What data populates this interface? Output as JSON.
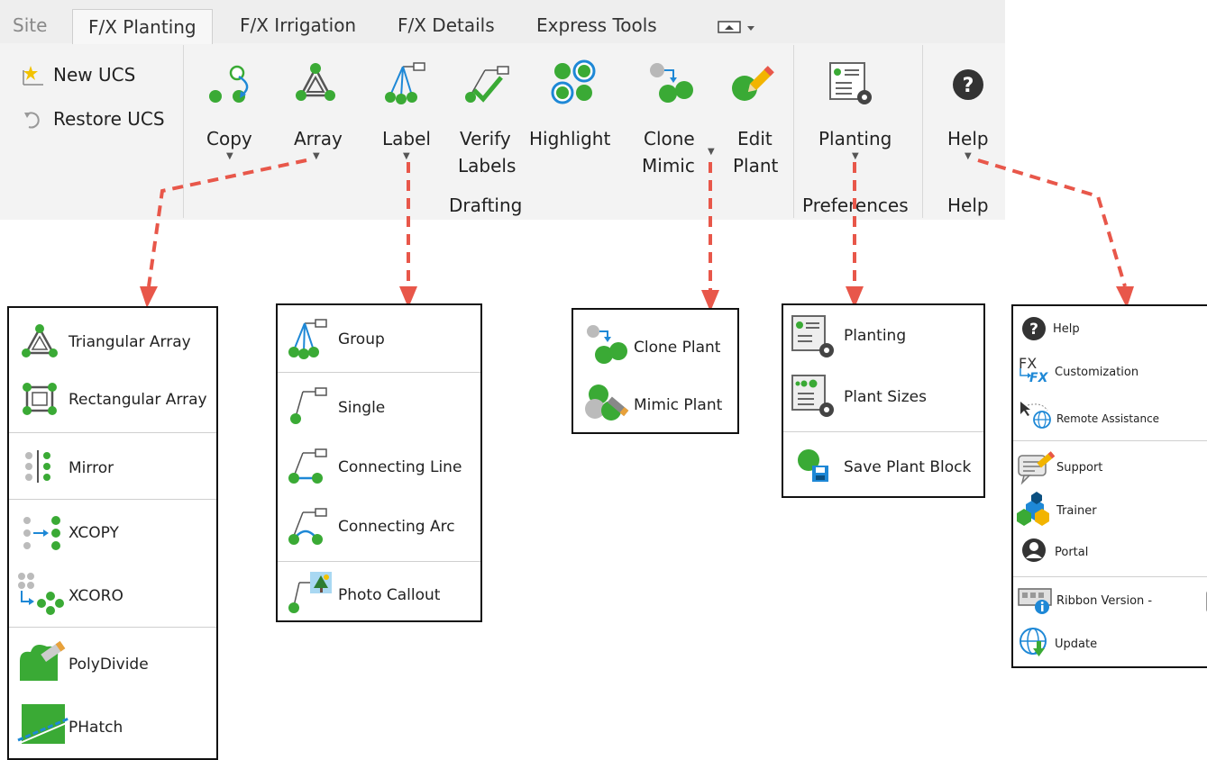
{
  "tabs": {
    "site": "Site",
    "planting": "F/X Planting",
    "irrigation": "F/X Irrigation",
    "details": "F/X Details",
    "express": "Express Tools"
  },
  "ucs": {
    "new": "New UCS",
    "restore": "Restore UCS"
  },
  "drafting": {
    "copy": "Copy",
    "array": "Array",
    "label": "Label",
    "verify_1": "Verify",
    "verify_2": "Labels",
    "highlight": "Highlight",
    "clone_1": "Clone",
    "clone_2": "Mimic",
    "edit_1": "Edit",
    "edit_2": "Plant",
    "group_label": "Drafting"
  },
  "preferences": {
    "planting": "Planting",
    "group_label": "Preferences"
  },
  "help_group": {
    "help": "Help",
    "group_label": "Help"
  },
  "array_menu": [
    "Triangular Array",
    "Rectangular Array",
    "Mirror",
    "XCOPY",
    "XCORO",
    "PolyDivide",
    "PHatch"
  ],
  "label_menu": [
    "Group",
    "Single",
    "Connecting Line",
    "Connecting Arc",
    "Photo Callout"
  ],
  "clone_menu": [
    "Clone Plant",
    "Mimic Plant"
  ],
  "planting_menu": [
    "Planting",
    "Plant Sizes",
    "Save Plant Block"
  ],
  "help_menu": {
    "items": [
      "Help",
      "Customization",
      "Remote Assistance",
      "Support",
      "Trainer",
      "Portal",
      "Ribbon Version -",
      "Update"
    ],
    "fx_top": "FX",
    "fx_bottom": "FX"
  },
  "colors": {
    "green": "#3aaa35",
    "blue": "#1e88d6",
    "arrow": "#e8574a",
    "gray": "#b8b8b8"
  }
}
